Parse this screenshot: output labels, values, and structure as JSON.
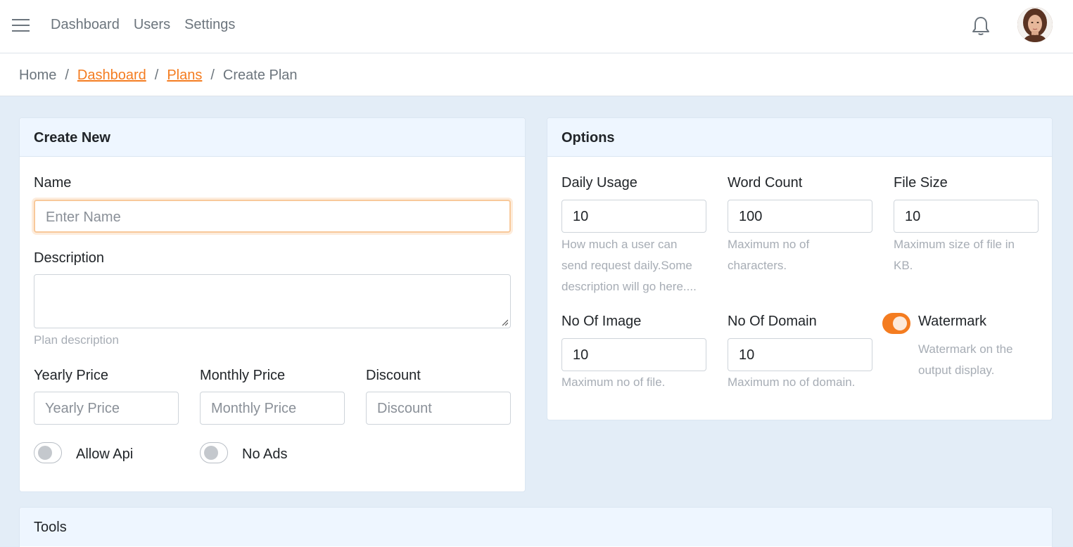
{
  "navbar": {
    "links": [
      "Dashboard",
      "Users",
      "Settings"
    ]
  },
  "breadcrumb": {
    "home": "Home",
    "dashboard": "Dashboard",
    "plans": "Plans",
    "current": "Create Plan",
    "separator": "/"
  },
  "create_card": {
    "title": "Create New",
    "name_label": "Name",
    "name_placeholder": "Enter Name",
    "description_label": "Description",
    "description_help": "Plan description",
    "yearly_label": "Yearly Price",
    "yearly_placeholder": "Yearly Price",
    "monthly_label": "Monthly Price",
    "monthly_placeholder": "Monthly Price",
    "discount_label": "Discount",
    "discount_placeholder": "Discount",
    "allow_api_label": "Allow Api",
    "allow_api_on": false,
    "no_ads_label": "No Ads",
    "no_ads_on": false
  },
  "options_card": {
    "title": "Options",
    "daily_usage_label": "Daily Usage",
    "daily_usage_value": "10",
    "daily_usage_help_1": "How much a user can",
    "daily_usage_help_2": "send request daily.Some",
    "daily_usage_help_3": "description will go here....",
    "word_count_label": "Word Count",
    "word_count_value": "100",
    "word_count_help_1": "Maximum no of",
    "word_count_help_2": "characters.",
    "file_size_label": "File Size",
    "file_size_value": "10",
    "file_size_help_1": "Maximum size of file in",
    "file_size_help_2": "KB.",
    "no_image_label": "No Of Image",
    "no_image_value": "10",
    "no_image_help": "Maximum no of file.",
    "no_domain_label": "No Of Domain",
    "no_domain_value": "10",
    "no_domain_help": "Maximum no of domain.",
    "watermark_label": "Watermark",
    "watermark_on": true,
    "watermark_help_1": "Watermark on the",
    "watermark_help_2": "output display."
  },
  "tools_card": {
    "title": "Tools"
  },
  "colors": {
    "accent": "#f47c20",
    "background": "#e3edf7",
    "card_header": "#eef6ff"
  }
}
